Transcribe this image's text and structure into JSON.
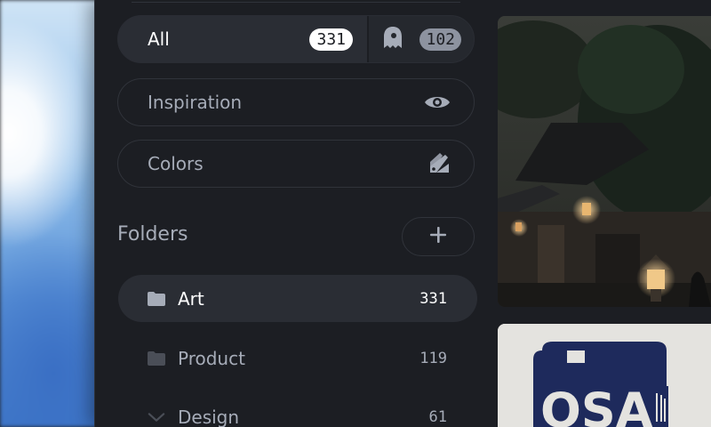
{
  "library": {
    "all_label": "All",
    "all_count": "331",
    "ghost_count": "102",
    "smart_items": [
      {
        "label": "Inspiration",
        "icon": "eye-icon"
      },
      {
        "label": "Colors",
        "icon": "palette-icon"
      }
    ]
  },
  "folders": {
    "title": "Folders",
    "add_icon": "plus-icon",
    "items": [
      {
        "name": "Art",
        "count": "331",
        "active": true,
        "icon": "folder-icon"
      },
      {
        "name": "Product",
        "count": "119",
        "active": false,
        "icon": "folder-icon"
      },
      {
        "name": "Design",
        "count": "61",
        "active": false,
        "icon": "chevron-down-icon"
      }
    ]
  },
  "gallery": {
    "tiles": [
      "pagoda-lantern-photo",
      "osa-can-poster"
    ],
    "poster_text": "OSA"
  },
  "colors": {
    "accent_white": "#ffffff",
    "panel_bg": "#1c1e23",
    "pill_bg": "#2a2d34"
  }
}
